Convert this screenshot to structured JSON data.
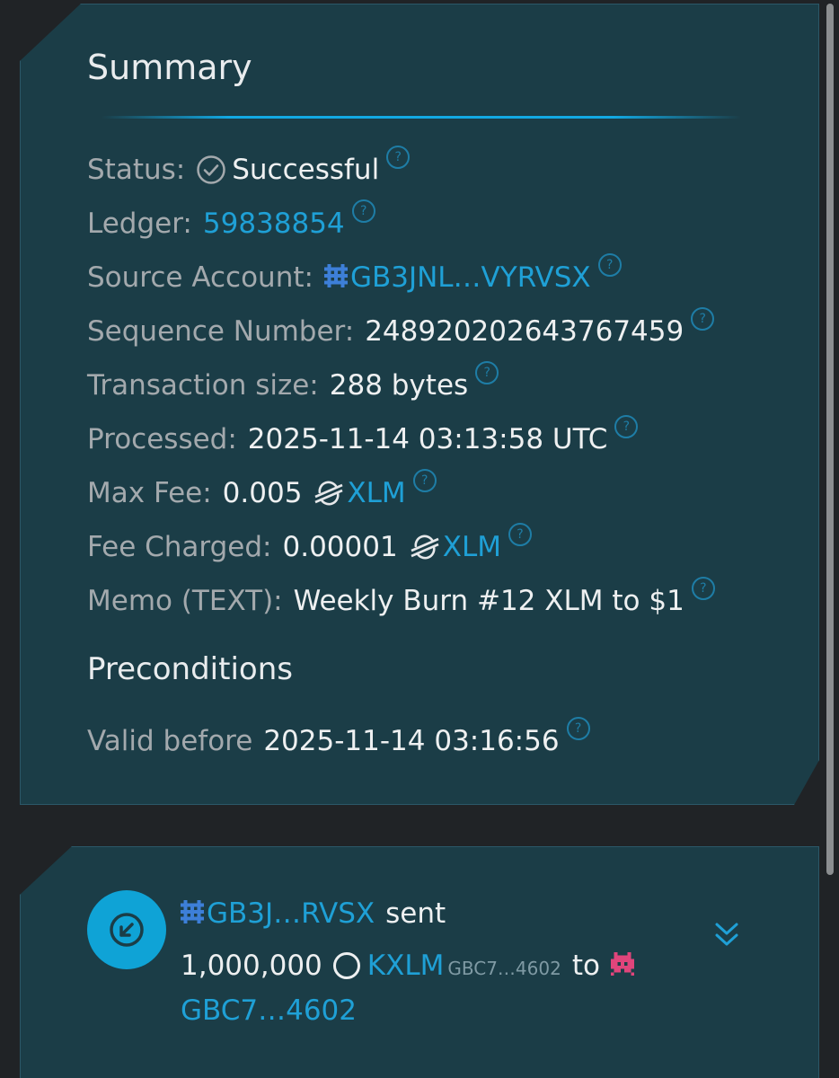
{
  "summary": {
    "title": "Summary",
    "status": {
      "label": "Status:",
      "value": "Successful",
      "icon": "check-circle-icon"
    },
    "ledger": {
      "label": "Ledger:",
      "value": "59838854"
    },
    "source_account": {
      "label": "Source Account:",
      "value": "GB3JNL…VYRVSX",
      "icon": "identicon-icon"
    },
    "sequence_number": {
      "label": "Sequence Number:",
      "value": "248920202643767459"
    },
    "transaction_size": {
      "label": "Transaction size:",
      "value": "288 bytes"
    },
    "processed": {
      "label": "Processed:",
      "value": "2025-11-14 03:13:58 UTC"
    },
    "max_fee": {
      "label": "Max Fee:",
      "amount": "0.005",
      "asset": "XLM",
      "icon": "stellar-icon"
    },
    "fee_charged": {
      "label": "Fee Charged:",
      "amount": "0.00001",
      "asset": "XLM",
      "icon": "stellar-icon"
    },
    "memo": {
      "label": "Memo (TEXT):",
      "value": "Weekly Burn #12 XLM to $1"
    },
    "help_glyph": "?"
  },
  "preconditions": {
    "title": "Preconditions",
    "valid_before": {
      "label": "Valid before",
      "value": "2025-11-14 03:16:56"
    }
  },
  "operation": {
    "source": "GB3J…RVSX",
    "verb": "sent",
    "amount": "1,000,000",
    "asset_code": "KXLM",
    "asset_issuer": "GBC7…4602",
    "preposition": "to",
    "destination": "GBC7…4602"
  },
  "colors": {
    "card": "#1b3d47",
    "background": "#202326",
    "accent": "#1fa0d6",
    "label": "#a3a9ad",
    "value": "#eef0f1",
    "identicon_blue": "#3d7fd8",
    "identicon_pink": "#e0457b"
  }
}
